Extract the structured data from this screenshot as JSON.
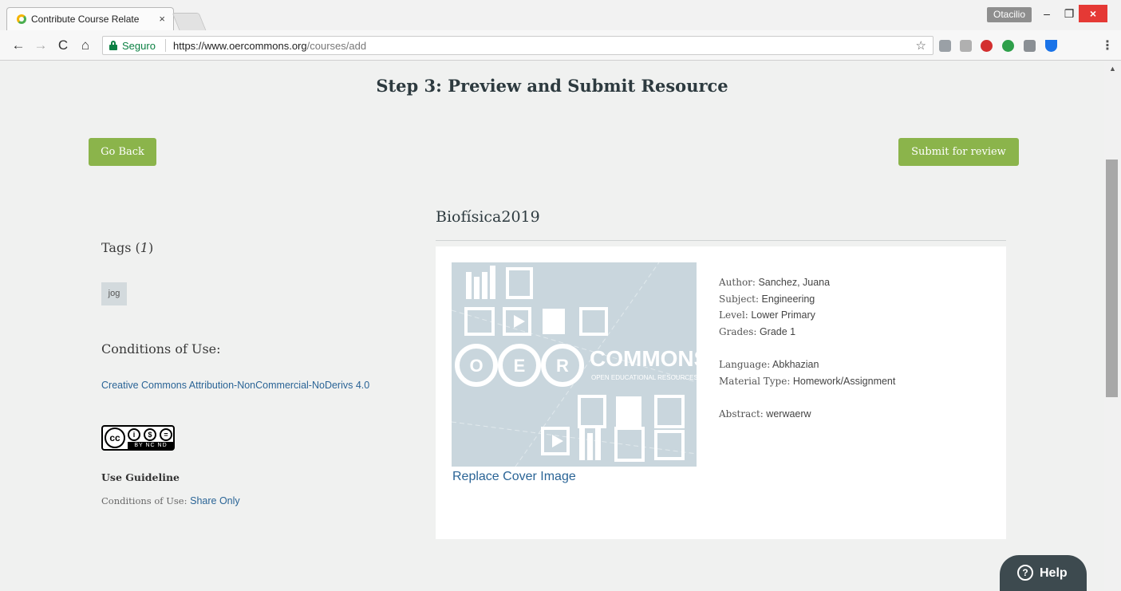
{
  "browser": {
    "tab_title": "Contribute Course Relate",
    "tab_close": "×",
    "user": "Otacilio",
    "window_min": "–",
    "window_max": "❐",
    "window_close": "×",
    "secure_label": "Seguro",
    "url_host": "https://www.oercommons.org",
    "url_path": "/courses/add",
    "nav_back": "←",
    "nav_forward": "→",
    "nav_reload": "C",
    "nav_home": "⌂",
    "star": "☆",
    "menu": "⋮",
    "extension_colors": [
      "#9aa0a6",
      "#b0b0b0",
      "#d32f2f",
      "#2e9f4a",
      "#8a8f94",
      "#1a73e8"
    ]
  },
  "page": {
    "step_title": "Step 3: Preview and Submit Resource",
    "go_back_label": "Go Back",
    "submit_label": "Submit for review",
    "accent_color": "#8bb44b"
  },
  "resource": {
    "title": "Biofísica2019",
    "replace_cover_label": "Replace Cover Image",
    "cover_logo_text": "COMMONS",
    "cover_logo_sub": "OPEN EDUCATIONAL RESOURCES",
    "cover_letters": [
      "O",
      "E",
      "R"
    ],
    "author_label": "Author:",
    "author": "Sanchez, Juana",
    "subject_label": "Subject:",
    "subject": "Engineering",
    "level_label": "Level:",
    "level": "Lower Primary",
    "grades_label": "Grades:",
    "grades": "Grade 1",
    "language_label": "Language:",
    "language": "Abkhazian",
    "material_type_label": "Material Type:",
    "material_type": "Homework/Assignment",
    "abstract_label": "Abstract:",
    "abstract": "werwaerw"
  },
  "sidebar": {
    "tags_heading": "Tags (",
    "tags_count": "1",
    "tags_close": ")",
    "tags": [
      "jog"
    ],
    "conditions_heading": "Conditions of Use:",
    "license_link": "Creative Commons Attribution-NonCommercial-NoDerivs 4.0",
    "license_badge_text": "BY NC ND",
    "use_guideline_heading": "Use Guideline",
    "conditions_label": "Conditions of Use:",
    "conditions_value": "Share Only"
  },
  "help": {
    "label": "Help",
    "icon_glyph": "?"
  }
}
